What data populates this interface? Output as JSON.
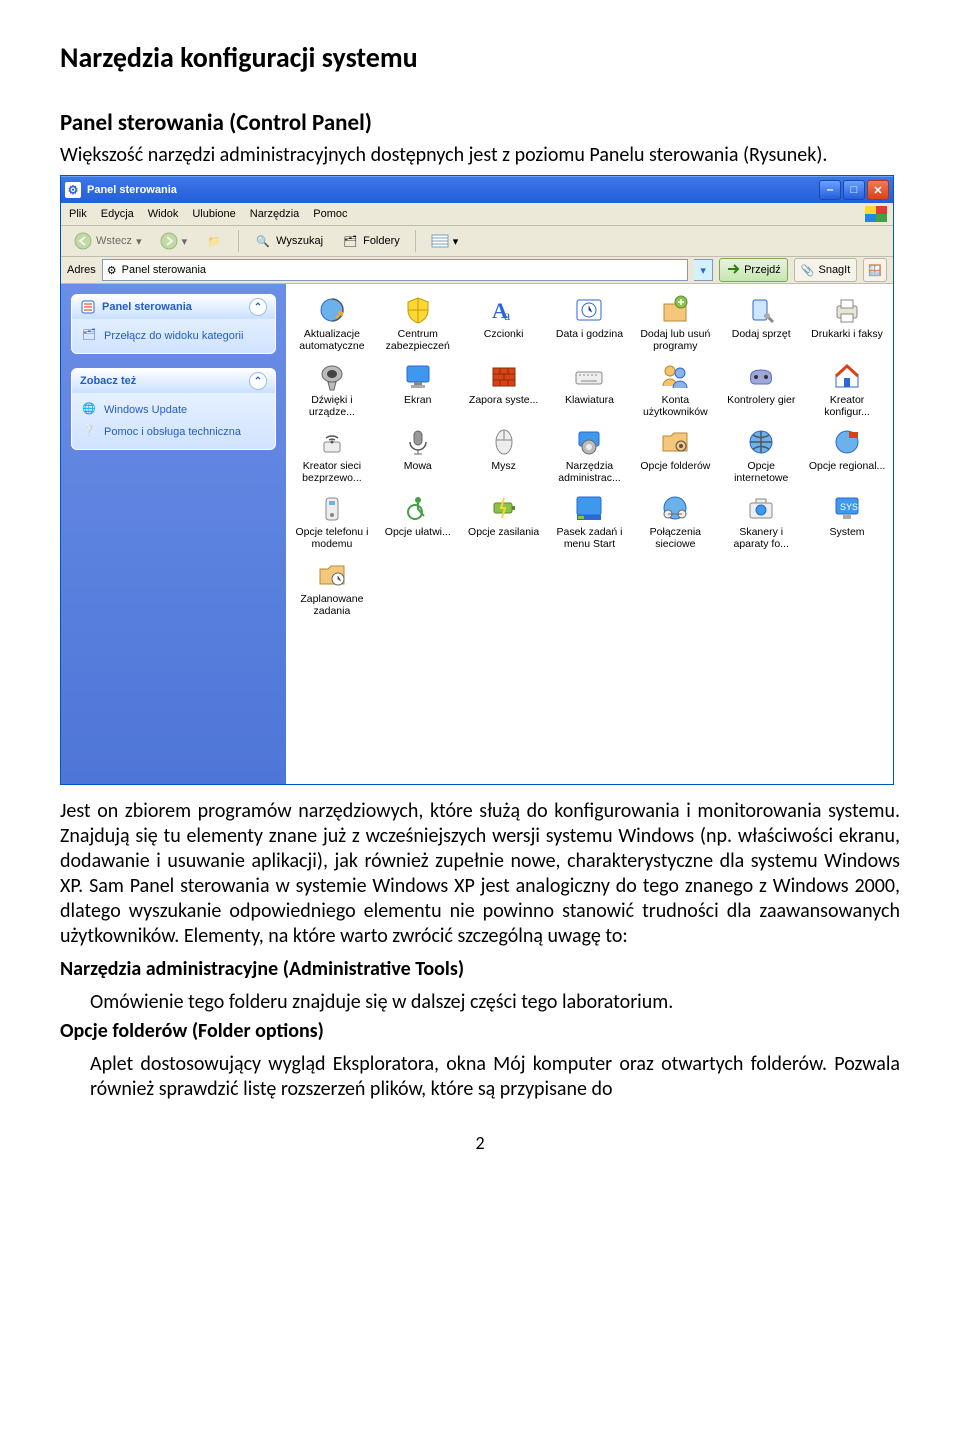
{
  "doc": {
    "h1": "Narzędzia konfiguracji systemu",
    "h2": "Panel sterowania (Control Panel)",
    "intro": "Większość narzędzi administracyjnych dostępnych jest z poziomu Panelu sterowania (Rysunek).",
    "body1": "Jest on zbiorem programów narzędziowych, które służą do konfigurowania i monitorowania systemu. Znajdują się tu elementy znane już z wcześniejszych wersji systemu Windows (np. właściwości ekranu, dodawanie i usuwanie aplikacji), jak również zupełnie nowe, charakterystyczne dla systemu Windows XP. Sam Panel sterowania w systemie Windows XP jest analogiczny do tego znanego z Windows 2000, dlatego wyszukanie odpowiedniego elementu nie powinno stanowić trudności dla zaawansowanych użytkowników. Elementy, na które warto zwrócić szczególną uwagę to:",
    "h3a": "Narzędzia administracyjne (Administrative Tools)",
    "sub_a": "Omówienie tego folderu znajduje się w dalszej części tego laboratorium.",
    "h3b": "Opcje folderów (Folder options)",
    "sub_b": "Aplet dostosowujący wygląd Eksploratora, okna Mój komputer oraz otwartych folderów. Pozwala również sprawdzić listę rozszerzeń plików, które są przypisane do",
    "page": "2"
  },
  "window": {
    "title": "Panel sterowania",
    "menu": {
      "file": "Plik",
      "edit": "Edycja",
      "view": "Widok",
      "favorites": "Ulubione",
      "tools": "Narzędzia",
      "help": "Pomoc"
    },
    "toolbar": {
      "back": "Wstecz",
      "search": "Wyszukaj",
      "folders": "Foldery"
    },
    "addressbar": {
      "label": "Adres",
      "value": "Panel sterowania",
      "go": "Przejdź",
      "snagit": "SnagIt"
    },
    "sidebar": {
      "pane1": {
        "title": "Panel sterowania",
        "switch": "Przełącz do widoku kategorii"
      },
      "pane2": {
        "title": "Zobacz też",
        "link1": "Windows Update",
        "link2": "Pomoc i obsługa techniczna"
      }
    },
    "icons": [
      {
        "label": "Aktualizacje automatyczne",
        "icon": "globe-arrow"
      },
      {
        "label": "Centrum zabezpieczeń",
        "icon": "shield"
      },
      {
        "label": "Czcionki",
        "icon": "font"
      },
      {
        "label": "Data i godzina",
        "icon": "clock"
      },
      {
        "label": "Dodaj lub usuń programy",
        "icon": "box-plus"
      },
      {
        "label": "Dodaj sprzęt",
        "icon": "wrench"
      },
      {
        "label": "Drukarki i faksy",
        "icon": "printer"
      },
      {
        "label": "Dźwięki i urządze...",
        "icon": "speaker"
      },
      {
        "label": "Ekran",
        "icon": "monitor"
      },
      {
        "label": "Zapora syste...",
        "icon": "firewall"
      },
      {
        "label": "Klawiatura",
        "icon": "keyboard"
      },
      {
        "label": "Konta użytkowników",
        "icon": "users"
      },
      {
        "label": "Kontrolery gier",
        "icon": "gamepad"
      },
      {
        "label": "Kreator konfigur...",
        "icon": "house"
      },
      {
        "label": "Kreator sieci bezprzewo...",
        "icon": "wifi"
      },
      {
        "label": "Mowa",
        "icon": "mic"
      },
      {
        "label": "Mysz",
        "icon": "mouse"
      },
      {
        "label": "Narzędzia administrac...",
        "icon": "tools"
      },
      {
        "label": "Opcje folderów",
        "icon": "folder-gear"
      },
      {
        "label": "Opcje internetowe",
        "icon": "globe"
      },
      {
        "label": "Opcje regional...",
        "icon": "globe-flag"
      },
      {
        "label": "Opcje telefonu i modemu",
        "icon": "phone"
      },
      {
        "label": "Opcje ułatwi...",
        "icon": "access"
      },
      {
        "label": "Opcje zasilania",
        "icon": "battery"
      },
      {
        "label": "Pasek zadań i menu Start",
        "icon": "taskbar"
      },
      {
        "label": "Połączenia sieciowe",
        "icon": "network"
      },
      {
        "label": "Skanery i aparaty fo...",
        "icon": "camera"
      },
      {
        "label": "System",
        "icon": "system"
      },
      {
        "label": "Zaplanowane zadania",
        "icon": "schedule"
      }
    ]
  }
}
